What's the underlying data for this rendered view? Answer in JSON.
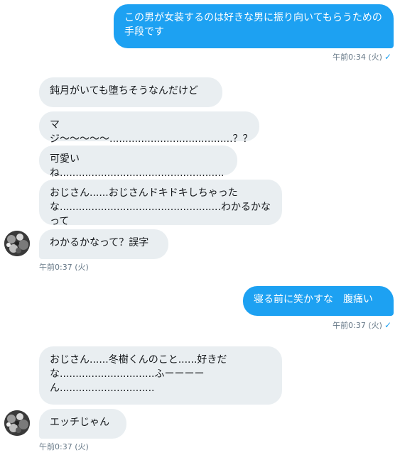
{
  "messages": [
    {
      "text": "この男が女装するのは好きな男に振り向いてもらうための手段です"
    },
    {
      "text": "鈍月がいても堕ちそうなんだけど"
    },
    {
      "text": "マジ〜〜〜〜〜.......................................？？"
    },
    {
      "text": "可愛いね...................................................."
    },
    {
      "text": "おじさん......おじさんドキドキしちゃったな...................................................わかるかなって"
    },
    {
      "text": "わかるかなって？誤字"
    },
    {
      "text": "寝る前に笑かすな　腹痛い"
    },
    {
      "text": "おじさん......冬樹くんのこと......好きだな..............................ふーーーーん.............................."
    },
    {
      "text": "エッチじゃん"
    }
  ],
  "timestamps": {
    "t1": "午前0:34 (火)",
    "t2": "午前0:37 (火)",
    "t3": "午前0:37 (火)",
    "t4": "午前0:37 (火)"
  },
  "icons": {
    "read_check": "✓",
    "avatar": "avatar-icon"
  },
  "colors": {
    "sent_bubble": "#1da1f2",
    "received_bubble": "#e9eef1",
    "timestamp": "#657786"
  }
}
